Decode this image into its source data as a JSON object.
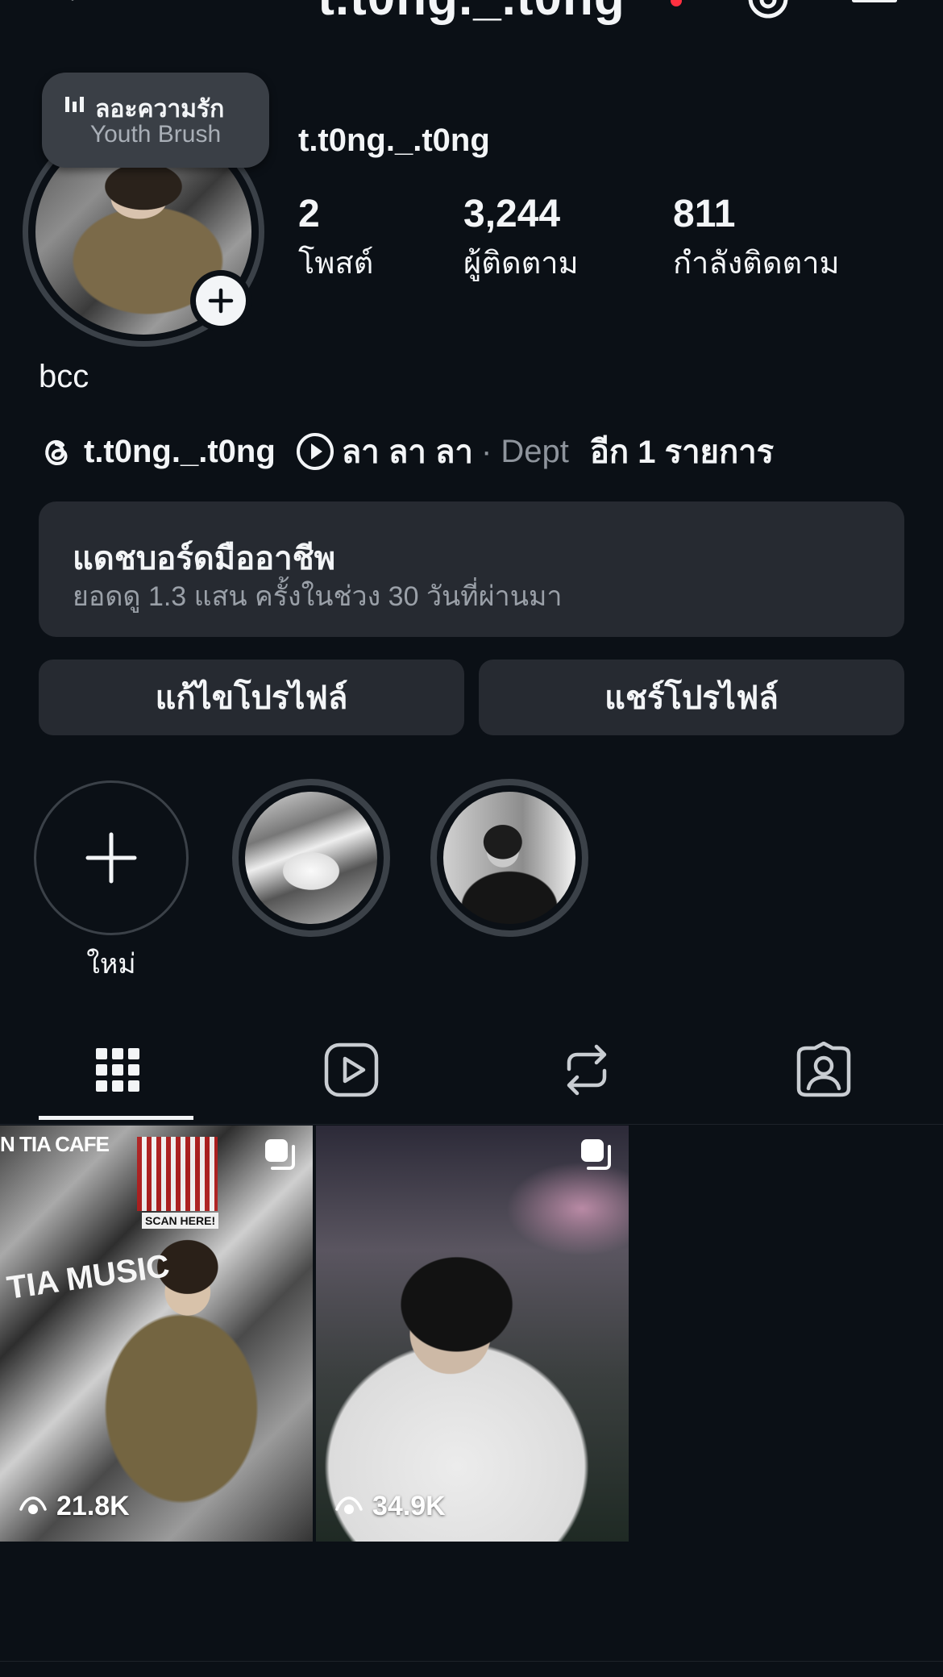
{
  "header": {
    "title": "t.t0ng._.t0ng"
  },
  "note": {
    "song": "ลอะความรัก",
    "artist": "Youth Brush"
  },
  "profile": {
    "username": "t.t0ng._.t0ng",
    "bio": "bcc",
    "stats": [
      {
        "value": "2",
        "label": "โพสต์"
      },
      {
        "value": "3,244",
        "label": "ผู้ติดตาม"
      },
      {
        "value": "811",
        "label": "กำลังติดตาม"
      }
    ]
  },
  "links": {
    "threads_handle": "t.t0ng._.t0ng",
    "music_title": "ลา ลา ลา",
    "music_artist": "· Dept",
    "more": "อีก 1 รายการ"
  },
  "dashboard": {
    "title": "แดชบอร์ดมืออาชีพ",
    "subtitle": "ยอดดู 1.3 แสน ครั้งในช่วง 30 วันที่ผ่านมา"
  },
  "buttons": {
    "edit_profile": "แก้ไขโปรไฟล์",
    "share_profile": "แชร์โปรไฟล์"
  },
  "highlights": {
    "new_label": "ใหม่"
  },
  "tabs": [
    "grid-icon",
    "reels-icon",
    "reposts-icon",
    "tagged-icon"
  ],
  "posts": [
    {
      "views": "21.8K",
      "overlay_text": "N TIA CAFE",
      "qr_caption": "SCAN HERE!",
      "poster_text": "TIA MUSIC"
    },
    {
      "views": "34.9K"
    }
  ],
  "colors": {
    "background": "#0b1016",
    "surface": "#262a31",
    "ring": "#3b4148",
    "text": "#f3f5f7",
    "muted": "#9aa0a8",
    "notification": "#ff3040"
  }
}
